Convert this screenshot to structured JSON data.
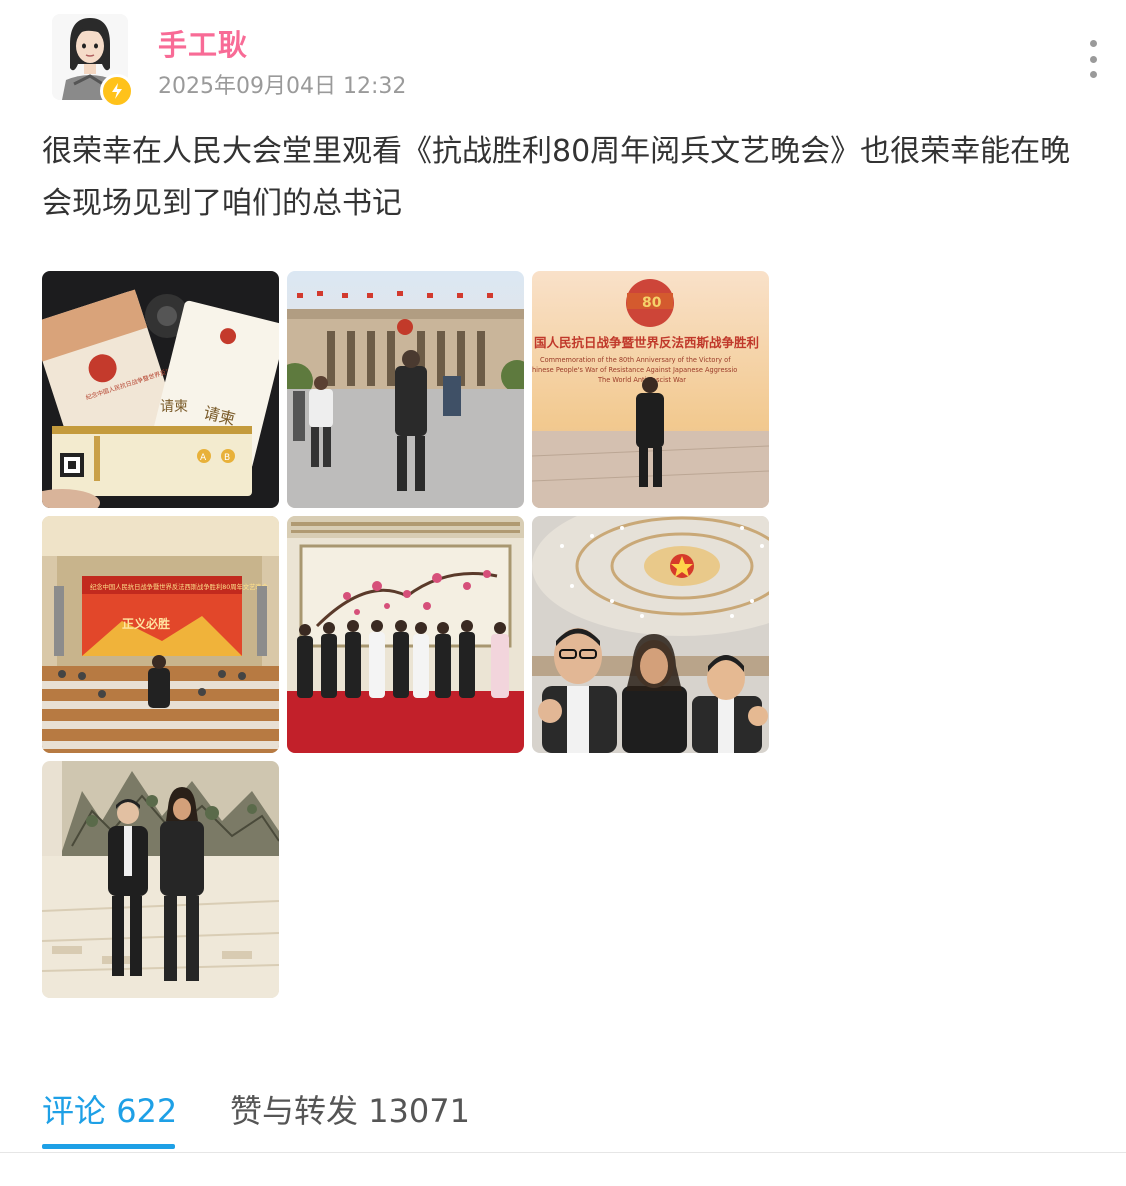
{
  "post": {
    "author": "手工耿",
    "timestamp": "2025年09月04日 12:32",
    "text": "很荣幸在人民大会堂里观看《抗战胜利80周年阅兵文艺晚会》也很荣幸能在晚会现场见到了咱们的总书记",
    "avatar_icon": "cartoon-avatar-icon",
    "badge_icon": "lightning-icon",
    "badge_color": "#ffc21a",
    "author_color": "#f86b96"
  },
  "photos": {
    "p1": {
      "sub": "纪念中国人民抗日战争暨世界反法西斯战争胜利80周年文艺晚会",
      "label_a": "请柬",
      "label_b": "请柬",
      "seat_a": "A",
      "seat_b": "B"
    },
    "p3": {
      "banner": "国人民抗日战争暨世界反法西斯战争胜利",
      "line1": "Commemoration of the 80th Anniversary of the Victory of",
      "line2": "hinese People's War of Resistance Against Japanese Aggressio",
      "line3": "The World Anti-Fascist War",
      "badge": "80"
    },
    "p4": {
      "banner": "纪念中国人民抗日战争暨世界反法西斯战争胜利80周年文艺晚会",
      "slogan": "正义必胜"
    }
  },
  "tabs": {
    "comments_label": "评论",
    "comments_count": "622",
    "likes_label": "赞与转发",
    "likes_count": "13071",
    "active_color": "#1ea0e6"
  }
}
